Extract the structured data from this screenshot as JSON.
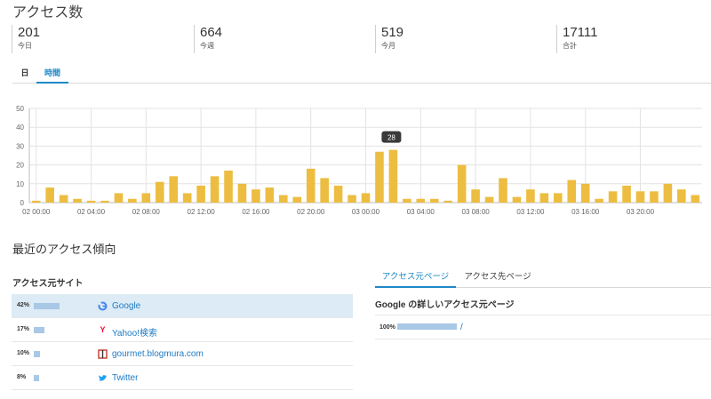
{
  "page_title": "アクセス数",
  "stats": [
    {
      "value": "201",
      "label": "今日"
    },
    {
      "value": "664",
      "label": "今週"
    },
    {
      "value": "519",
      "label": "今月"
    },
    {
      "value": "17111",
      "label": "合計"
    }
  ],
  "period_tabs": [
    {
      "label": "日",
      "active": false
    },
    {
      "label": "時間",
      "active": true
    }
  ],
  "chart_data": {
    "type": "bar",
    "categories": [
      "02 00:00",
      "02 01:00",
      "02 02:00",
      "02 03:00",
      "02 04:00",
      "02 05:00",
      "02 06:00",
      "02 07:00",
      "02 08:00",
      "02 09:00",
      "02 10:00",
      "02 11:00",
      "02 12:00",
      "02 13:00",
      "02 14:00",
      "02 15:00",
      "02 16:00",
      "02 17:00",
      "02 18:00",
      "02 19:00",
      "02 20:00",
      "02 21:00",
      "02 22:00",
      "02 23:00",
      "03 00:00",
      "03 01:00",
      "03 02:00",
      "03 03:00",
      "03 04:00",
      "03 05:00",
      "03 06:00",
      "03 07:00",
      "03 08:00",
      "03 09:00",
      "03 10:00",
      "03 11:00",
      "03 12:00",
      "03 13:00",
      "03 14:00",
      "03 15:00",
      "03 16:00",
      "03 17:00",
      "03 18:00",
      "03 19:00",
      "03 20:00",
      "03 21:00",
      "03 22:00",
      "03 23:00"
    ],
    "values": [
      1,
      8,
      4,
      2,
      1,
      1,
      5,
      2,
      5,
      11,
      14,
      5,
      9,
      14,
      17,
      10,
      7,
      8,
      4,
      3,
      18,
      13,
      9,
      4,
      5,
      27,
      28,
      2,
      2,
      2,
      1,
      20,
      7,
      3,
      13,
      3,
      7,
      5,
      5,
      12,
      10,
      2,
      6,
      9,
      6,
      6,
      10,
      7,
      4
    ],
    "x_tick_labels": [
      "02 00:00",
      "02 04:00",
      "02 08:00",
      "02 12:00",
      "02 16:00",
      "02 20:00",
      "03 00:00",
      "03 04:00",
      "03 08:00",
      "03 12:00",
      "03 16:00",
      "03 20:00"
    ],
    "y_ticks": [
      0,
      10,
      20,
      30,
      40,
      50
    ],
    "ylim": [
      0,
      50
    ],
    "tooltip": {
      "label": "28",
      "category_index": 26
    },
    "bar_color": "#ecbd40",
    "grid": true
  },
  "recent_title": "最近のアクセス傾向",
  "referrer_sites": {
    "heading": "アクセス元サイト",
    "items": [
      {
        "percent": "42%",
        "ratio": 0.42,
        "name": "Google",
        "icon": "google-icon",
        "highlight": true
      },
      {
        "percent": "17%",
        "ratio": 0.17,
        "name": "Yahoo!検索",
        "icon": "yahoo-icon",
        "highlight": false
      },
      {
        "percent": "10%",
        "ratio": 0.1,
        "name": "gourmet.blogmura.com",
        "icon": "blogmura-icon",
        "highlight": false
      },
      {
        "percent": "8%",
        "ratio": 0.08,
        "name": "Twitter",
        "icon": "twitter-icon",
        "highlight": false
      }
    ]
  },
  "page_tabs": [
    {
      "label": "アクセス元ページ",
      "active": true
    },
    {
      "label": "アクセス先ページ",
      "active": false
    }
  ],
  "google_pages": {
    "heading": "Google の詳しいアクセス元ページ",
    "items": [
      {
        "percent": "100%",
        "ratio": 1.0,
        "name": "/"
      }
    ]
  },
  "colors": {
    "accent": "#1e88c8",
    "bar": "#ecbd40",
    "ref_bar": "#a8c8e6",
    "highlight_row": "#dcebf5"
  }
}
